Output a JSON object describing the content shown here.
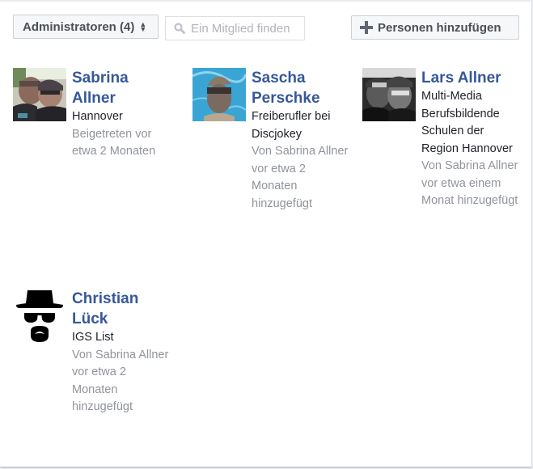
{
  "toolbar": {
    "role_filter_label": "Administratoren (4)",
    "search_placeholder": "Ein Mitglied finden",
    "add_people_label": "Personen hinzufügen"
  },
  "members": [
    {
      "name": "Sabrina Allner",
      "detail": "Hannover",
      "meta": "Beigetreten vor etwa 2 Monaten",
      "avatar": "photo-two-people-selfie"
    },
    {
      "name": "Sascha Perschke",
      "detail": "Freiberufler bei Discjokey",
      "meta": "Von Sabrina Allner vor etwa 2 Monaten hinzugefügt",
      "avatar": "photo-underwater-portrait"
    },
    {
      "name": "Lars Allner",
      "detail": "Multi-Media Berufsbildende Schulen der Region Hannover",
      "meta": "Von Sabrina Allner vor etwa einem Monat hinzugefügt",
      "avatar": "photo-black-white-two-people"
    },
    {
      "name": "Christian Lück",
      "detail": "IGS List",
      "meta": "Von Sabrina Allner vor etwa 2 Monaten hinzugefügt",
      "avatar": "heisenberg-icon"
    }
  ],
  "colors": {
    "link": "#365899",
    "meta_text": "#90949c",
    "button_bg": "#f6f7f9",
    "border": "#ccd0d5"
  }
}
